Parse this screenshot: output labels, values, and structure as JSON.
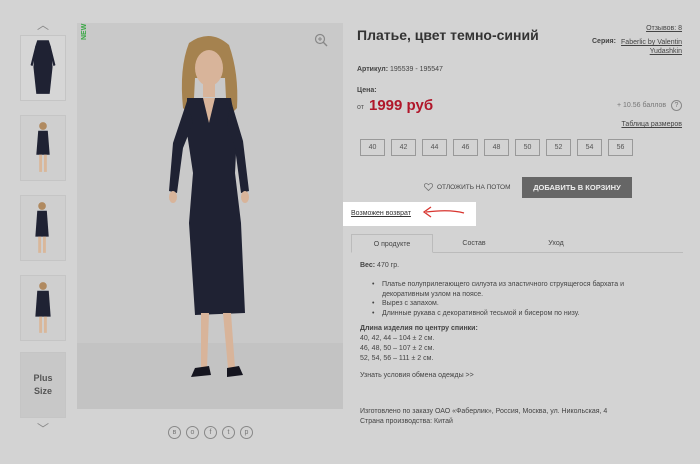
{
  "gallery": {
    "badge": "NEW",
    "plus_size_line1": "Plus",
    "plus_size_line2": "Size",
    "share_icons": [
      "vk-icon",
      "ok-icon",
      "facebook-icon",
      "twitter-icon",
      "pinterest-icon"
    ],
    "share_glyphs": [
      "в",
      "о",
      "f",
      "t",
      "p"
    ]
  },
  "product": {
    "title": "Платье, цвет темно-синий",
    "reviews": "Отзывов: 8",
    "series_label": "Серия:",
    "series_value": "Faberlic by Valentin Yudashkin",
    "article_label": "Артикул:",
    "article_value": "195539 - 195547",
    "price_label": "Цена:",
    "price_from": "от",
    "price": "1999 руб",
    "bonus": "+ 10.56 баллов",
    "size_table": "Таблица размеров",
    "sizes": [
      "40",
      "42",
      "44",
      "46",
      "48",
      "50",
      "52",
      "54",
      "56"
    ],
    "wishlist": "ОТЛОЖИТЬ НА ПОТОМ",
    "add_to_cart": "ДОБАВИТЬ В КОРЗИНУ",
    "return_link": "Возможен возврат"
  },
  "tabs": [
    "О продукте",
    "Состав",
    "Уход"
  ],
  "details": {
    "weight_label": "Вес:",
    "weight_value": "470 гр.",
    "bullets": [
      "Платье полуприлегающего силуэта из эластичного струящегося бархата и декоративным узлом на поясе.",
      "Вырез с запахом.",
      "Длинные рукава с декоративной тесьмой и бисером по низу."
    ],
    "length_title": "Длина изделия по центру спинки:",
    "length_lines": [
      "40, 42, 44 – 104 ± 2 см.",
      "46, 48, 50 – 107 ± 2 см.",
      "52, 54, 56 – 111 ± 2 см."
    ],
    "exchange_link": "Узнать условия обмена одежды >>",
    "manufacturer": "Изготовлено по заказу ОАО «Фаберлик», Россия, Москва, ул. Никольская, 4",
    "country": "Страна производства: Китай"
  },
  "colors": {
    "accent_price": "#b0162a",
    "cart_button": "#666666",
    "new_badge": "#3aa845",
    "dress": "#1f2233"
  }
}
